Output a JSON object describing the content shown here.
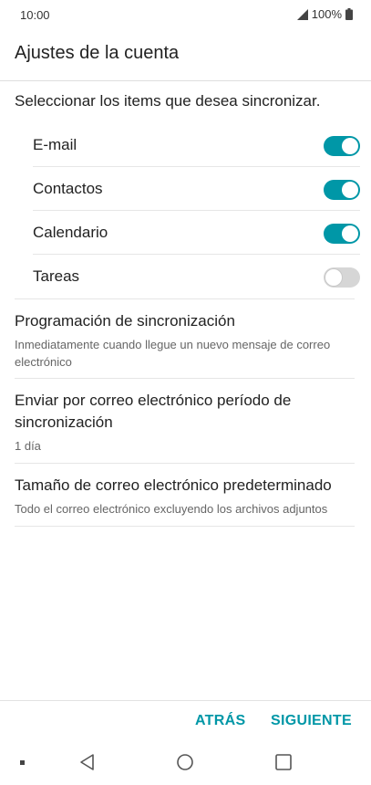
{
  "status_bar": {
    "time": "10:00",
    "battery": "100%"
  },
  "header": {
    "title": "Ajustes de la cuenta"
  },
  "sync": {
    "hint": "Seleccionar los items que desea sincronizar.",
    "items": [
      {
        "label": "E-mail",
        "enabled": true
      },
      {
        "label": "Contactos",
        "enabled": true
      },
      {
        "label": "Calendario",
        "enabled": true
      },
      {
        "label": "Tareas",
        "enabled": false
      }
    ]
  },
  "settings": [
    {
      "title": "Programación de sincronización",
      "summary": "Inmediatamente cuando llegue un nuevo mensaje de correo electrónico"
    },
    {
      "title": "Enviar por correo electrónico período de sincronización",
      "summary": "1 día"
    },
    {
      "title": "Tamaño de correo electrónico predeterminado",
      "summary": "Todo el correo electrónico excluyendo los archivos adjuntos"
    }
  ],
  "actions": {
    "back": "ATRÁS",
    "next": "SIGUIENTE"
  },
  "colors": {
    "accent": "#0097a7",
    "switch_off": "#d6d6d6"
  },
  "nav_icons": [
    "square-dot-icon",
    "back-triangle-icon",
    "home-circle-icon",
    "recents-square-icon"
  ]
}
